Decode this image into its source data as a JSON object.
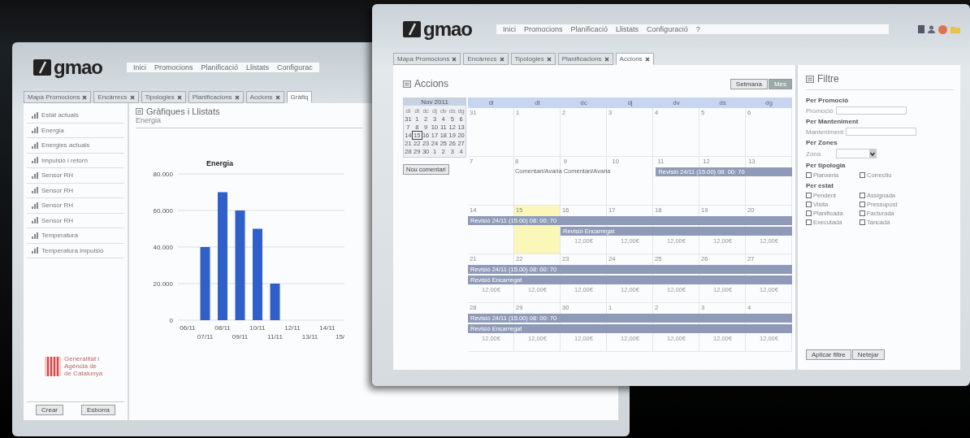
{
  "back_window": {
    "logo": "gmao",
    "menu": [
      "Inici",
      "Promocions",
      "Planificació",
      "Llistats",
      "Configurac"
    ],
    "tabs": [
      {
        "label": "Mapa Promocions",
        "selected": false,
        "closable": true
      },
      {
        "label": "Encàrrecs",
        "selected": false,
        "closable": true
      },
      {
        "label": "Tipologies",
        "selected": false,
        "closable": true
      },
      {
        "label": "Planificacions",
        "selected": false,
        "closable": true
      },
      {
        "label": "Accions",
        "selected": false,
        "closable": true
      },
      {
        "label": "Gràfiq",
        "selected": true,
        "closable": false
      }
    ],
    "sidebar": {
      "items": [
        "Estat actuals",
        "Energia",
        "Energies actuals",
        "Impulsió i retorn",
        "Sensor RH",
        "Sensor RH",
        "Sensor RH",
        "Sensor RH",
        "Temperatura",
        "Temperatura impulsió"
      ],
      "org_lines": [
        "Generalitat i",
        "Agència de",
        "de Catalunya"
      ],
      "buttons": [
        "Crear",
        "Esborra"
      ]
    },
    "panel": {
      "title": "Gràfiques i Llistats",
      "subtitle": "Energia",
      "chart_data": {
        "type": "bar",
        "title": "Energia",
        "categories": [
          "06/11",
          "07/11",
          "08/11",
          "09/11",
          "10/11",
          "11/11",
          "12/11",
          "13/11",
          "14/11",
          "15/"
        ],
        "series": [
          {
            "color": "#2f5fc8",
            "values": [
              null,
              40000,
              70000,
              60000,
              50000,
              20000,
              null,
              null,
              null,
              null
            ]
          }
        ],
        "grid": true,
        "ylim": [
          0,
          80000
        ],
        "yticks": [
          {
            "value": 0,
            "label": "0"
          },
          {
            "value": 20000,
            "label": "20.000"
          },
          {
            "value": 40000,
            "label": "40.000"
          },
          {
            "value": 60000,
            "label": "60.000"
          },
          {
            "value": 80000,
            "label": "80.000"
          }
        ]
      }
    }
  },
  "front_window": {
    "logo": "gmao",
    "menu": [
      "Inici",
      "Promocions",
      "Planificació",
      "Llistats",
      "Configuració",
      "?"
    ],
    "tabs": [
      {
        "label": "Mapa Promocions",
        "selected": false
      },
      {
        "label": "Encàrrecs",
        "selected": false
      },
      {
        "label": "Tipologies",
        "selected": false
      },
      {
        "label": "Planificacions",
        "selected": false
      },
      {
        "label": "Accions",
        "selected": true
      }
    ],
    "title": "Accions",
    "view_buttons": [
      {
        "label": "Setmana",
        "selected": false
      },
      {
        "label": "Mes",
        "selected": true
      }
    ],
    "mini_calendar": {
      "title": "Nov 2011",
      "weekdays": [
        "dl",
        "dt",
        "dc",
        "dj",
        "dv",
        "ds",
        "dg"
      ],
      "weeks": [
        [
          {
            "label": "31",
            "selected": false
          },
          {
            "label": "1",
            "selected": false
          },
          {
            "label": "2",
            "selected": false
          },
          {
            "label": "3",
            "selected": false
          },
          {
            "label": "4",
            "selected": false
          },
          {
            "label": "5",
            "selected": false
          },
          {
            "label": "6",
            "selected": false
          }
        ],
        [
          {
            "label": "7",
            "selected": false
          },
          {
            "label": "8",
            "selected": false
          },
          {
            "label": "9",
            "selected": false
          },
          {
            "label": "10",
            "selected": false
          },
          {
            "label": "11",
            "selected": false
          },
          {
            "label": "12",
            "selected": false
          },
          {
            "label": "13",
            "selected": false
          }
        ],
        [
          {
            "label": "14",
            "selected": false
          },
          {
            "label": "15",
            "selected": true
          },
          {
            "label": "16",
            "selected": false
          },
          {
            "label": "17",
            "selected": false
          },
          {
            "label": "18",
            "selected": false
          },
          {
            "label": "19",
            "selected": false
          },
          {
            "label": "20",
            "selected": false
          }
        ],
        [
          {
            "label": "21",
            "selected": false
          },
          {
            "label": "22",
            "selected": false
          },
          {
            "label": "23",
            "selected": false
          },
          {
            "label": "24",
            "selected": false
          },
          {
            "label": "25",
            "selected": false
          },
          {
            "label": "26",
            "selected": false
          },
          {
            "label": "27",
            "selected": false
          }
        ],
        [
          {
            "label": "28",
            "selected": false
          },
          {
            "label": "29",
            "selected": false
          },
          {
            "label": "30",
            "selected": false
          },
          {
            "label": "1",
            "selected": false
          },
          {
            "label": "2",
            "selected": false
          },
          {
            "label": "3",
            "selected": false
          },
          {
            "label": "4",
            "selected": false
          }
        ]
      ],
      "button": "Nou comentari"
    },
    "calendar": {
      "weekdays": [
        "dl",
        "dt",
        "dc",
        "dj",
        "dv",
        "ds",
        "dg"
      ],
      "weeks": [
        {
          "days": [
            {
              "label": "31",
              "today": false
            },
            {
              "label": "1",
              "today": false
            },
            {
              "label": "2",
              "today": false
            },
            {
              "label": "3",
              "today": false
            },
            {
              "label": "4",
              "today": false
            },
            {
              "label": "5",
              "today": false
            },
            {
              "label": "6",
              "today": false
            }
          ]
        },
        {
          "days": [
            {
              "label": "7",
              "today": false
            },
            {
              "label": "8",
              "today": false,
              "note": "Comentari/Avaria"
            },
            {
              "label": "9",
              "today": false,
              "note": "Comentari/Avaria"
            },
            {
              "label": "10",
              "today": false
            },
            {
              "label": "11",
              "today": false,
              "events": [
                "Revisió 24/11 (15.00) 08: 00: 70"
              ]
            },
            {
              "label": "12",
              "today": false
            },
            {
              "label": "13",
              "today": false
            }
          ]
        },
        {
          "days": [
            {
              "label": "14",
              "today": false,
              "events": [
                "Revisió 24/11 (15.00) 08: 00: 70"
              ]
            },
            {
              "label": "15",
              "today": true
            },
            {
              "label": "16",
              "today": false,
              "events": [
                "Revisió Encarregat"
              ],
              "cost": "12,00€"
            },
            {
              "label": "17",
              "today": false,
              "cost": "12,00€"
            },
            {
              "label": "18",
              "today": false,
              "cost": "12,00€"
            },
            {
              "label": "19",
              "today": false,
              "cost": "12,00€"
            },
            {
              "label": "20",
              "today": false,
              "cost": "12,00€"
            }
          ]
        },
        {
          "days": [
            {
              "label": "21",
              "today": false,
              "events": [
                "Revisió 24/11 (15.00) 08: 00: 70",
                "Revisió Encarregat"
              ],
              "cost": "12,00€"
            },
            {
              "label": "22",
              "today": false,
              "cost": "12,00€"
            },
            {
              "label": "23",
              "today": false,
              "cost": "12,00€"
            },
            {
              "label": "24",
              "today": false,
              "cost": "12,00€"
            },
            {
              "label": "25",
              "today": false,
              "cost": "12,00€"
            },
            {
              "label": "26",
              "today": false,
              "cost": "12,00€"
            },
            {
              "label": "27",
              "today": false,
              "cost": "12,00€"
            }
          ]
        },
        {
          "days": [
            {
              "label": "28",
              "today": false,
              "events": [
                "Revisió 24/11 (15.00) 08: 00: 70",
                "Revisió Encarregat"
              ],
              "cost": "12,00€"
            },
            {
              "label": "29",
              "today": false,
              "cost": "12,00€"
            },
            {
              "label": "30",
              "today": false,
              "cost": "12,00€"
            },
            {
              "label": "1",
              "today": false,
              "cost": "12,00€"
            },
            {
              "label": "2",
              "today": false,
              "cost": "12,00€"
            },
            {
              "label": "3",
              "today": false,
              "cost": "12,00€"
            },
            {
              "label": "4",
              "today": false,
              "cost": "12,00€"
            }
          ]
        }
      ]
    },
    "filter": {
      "title": "Filtre",
      "sections": [
        {
          "kind": "text",
          "heading": "Per Promoció",
          "label": "Promoció"
        },
        {
          "kind": "text",
          "heading": "Per Manteniment",
          "label": "Manteniment"
        },
        {
          "kind": "select",
          "heading": "Per Zones",
          "label": "Zona"
        },
        {
          "kind": "checks",
          "heading": "Per tipologia",
          "options": [
            {
              "label": "Planxeria",
              "checked": false
            },
            {
              "label": "Correctiu",
              "checked": false
            }
          ]
        },
        {
          "kind": "checks",
          "heading": "Per estat",
          "options": [
            {
              "label": "Pendent",
              "checked": false
            },
            {
              "label": "Assignada",
              "checked": false
            },
            {
              "label": "Visita",
              "checked": false
            },
            {
              "label": "Pressupost",
              "checked": false
            },
            {
              "label": "Planificada",
              "checked": false
            },
            {
              "label": "Facturada",
              "checked": false
            },
            {
              "label": "Executada",
              "checked": false
            },
            {
              "label": "Tancada",
              "checked": false
            }
          ]
        }
      ],
      "buttons": [
        "Aplicar filtre",
        "Netejar"
      ]
    }
  }
}
